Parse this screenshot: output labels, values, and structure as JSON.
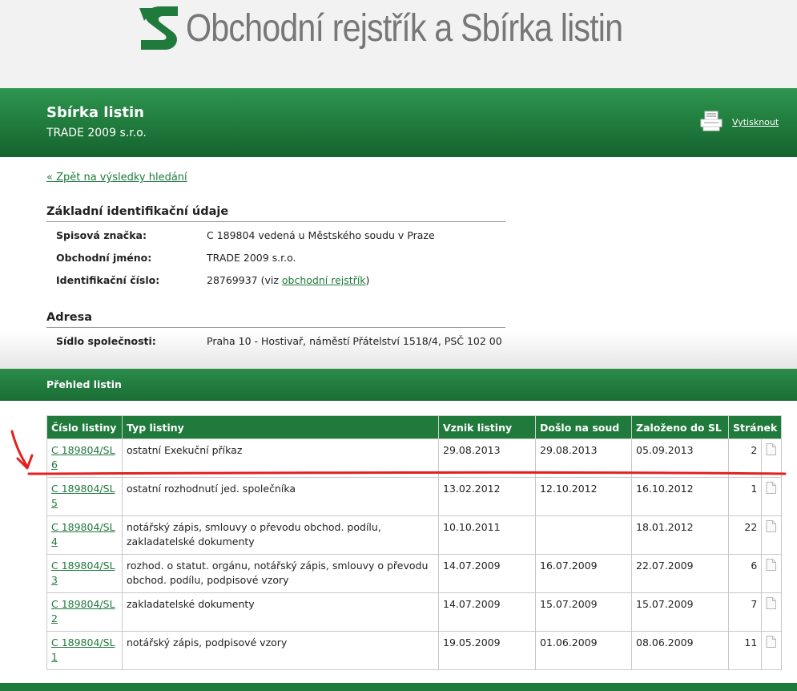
{
  "header": {
    "site_title": "Obchodní rejstřík a Sbírka listin",
    "logo_icon": "green-s-logo-icon"
  },
  "banner": {
    "heading": "Sbírka listin",
    "company": "TRADE 2009 s.r.o.",
    "print_label": "Vytisknout",
    "print_icon": "printer-icon"
  },
  "back_link": "« Zpět na výsledky hledání",
  "identification": {
    "title": "Základní identifikační údaje",
    "file_number_label": "Spisová značka:",
    "file_number_value": "C 189804 vedená u Městského soudu v Praze",
    "business_name_label": "Obchodní jméno:",
    "business_name_value": "TRADE 2009 s.r.o.",
    "id_label": "Identifikační číslo:",
    "id_value": "28769937",
    "id_prefix": "(viz ",
    "id_link": "obchodní rejstřík",
    "id_suffix": ")"
  },
  "address": {
    "title": "Adresa",
    "seat_label": "Sídlo společnosti:",
    "seat_value": "Praha 10 - Hostivař, náměstí Přátelství 1518/4, PSČ 102 00"
  },
  "overview": {
    "title": "Přehled listin",
    "columns": [
      "Číslo listiny",
      "Typ listiny",
      "Vznik listiny",
      "Došlo na soud",
      "Založeno do SL",
      "Stránek"
    ],
    "rows": [
      {
        "number": "C 189804/SL 6",
        "type": "ostatní Exekuční příkaz",
        "created": "29.08.2013",
        "received": "29.08.2013",
        "filed": "05.09.2013",
        "pages": "2"
      },
      {
        "number": "C 189804/SL 5",
        "type": "ostatní rozhodnutí jed. společníka",
        "created": "13.02.2012",
        "received": "12.10.2012",
        "filed": "16.10.2012",
        "pages": "1"
      },
      {
        "number": "C 189804/SL 4",
        "type": "notářský zápis, smlouvy o převodu obchod. podílu, zakladatelské dokumenty",
        "created": "10.10.2011",
        "received": "",
        "filed": "18.01.2012",
        "pages": "22"
      },
      {
        "number": "C 189804/SL 3",
        "type": "rozhod. o statut. orgánu, notářský zápis, smlouvy o převodu obchod. podílu, podpisové vzory",
        "created": "14.07.2009",
        "received": "16.07.2009",
        "filed": "22.07.2009",
        "pages": "6"
      },
      {
        "number": "C 189804/SL 2",
        "type": "zakladatelské dokumenty",
        "created": "14.07.2009",
        "received": "15.07.2009",
        "filed": "15.07.2009",
        "pages": "7"
      },
      {
        "number": "C 189804/SL 1",
        "type": "notářský zápis, podpisové vzory",
        "created": "19.05.2009",
        "received": "01.06.2009",
        "filed": "08.06.2009",
        "pages": "11"
      }
    ],
    "row_icon": "document-icon"
  },
  "annotation": {
    "color": "#e32020",
    "arrow_icon": "hand-drawn-arrow-icon"
  }
}
